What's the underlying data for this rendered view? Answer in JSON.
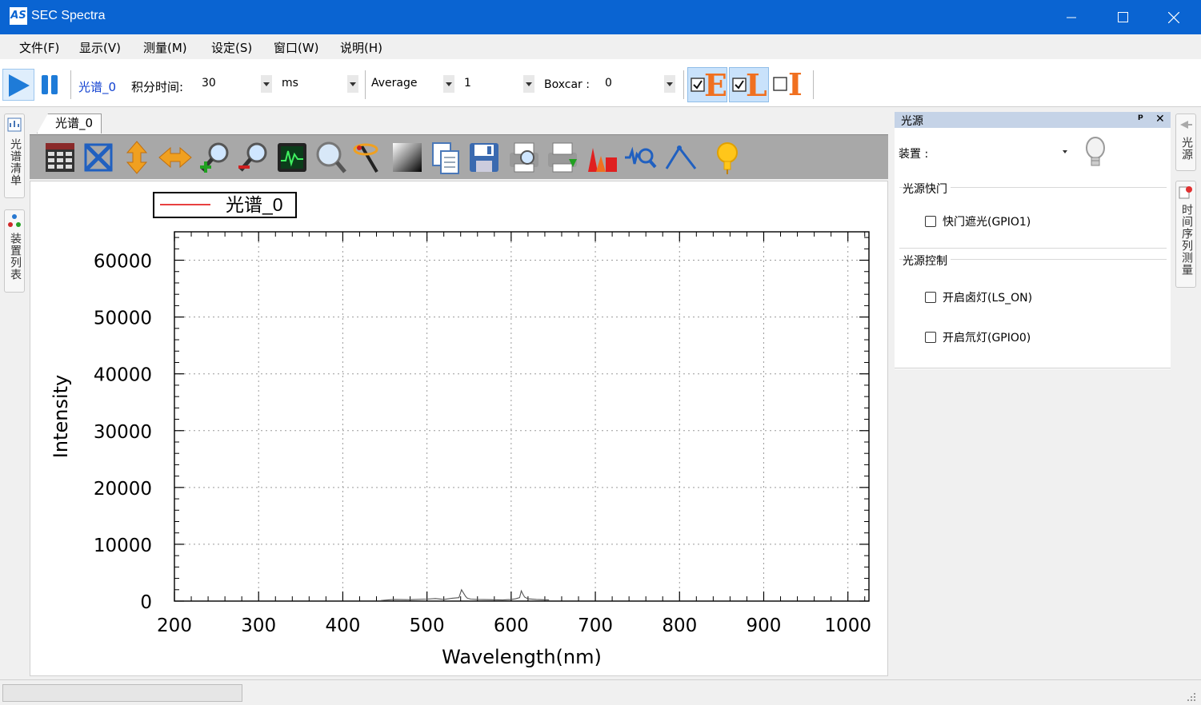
{
  "window": {
    "title": "SEC Spectra",
    "logo_text": "AS"
  },
  "menu": [
    "文件(F)",
    "显示(V)",
    "测量(M)",
    "设定(S)",
    "窗口(W)",
    "说明(H)"
  ],
  "toolbar": {
    "spectrum_link": "光谱_0",
    "integration_label": "积分时间:",
    "integration_value": "30",
    "unit_value": "ms",
    "mode_value": "Average",
    "average_value": "1",
    "boxcar_label": "Boxcar :",
    "boxcar_value": "0",
    "toggle_e": "E",
    "toggle_l": "L",
    "toggle_i": "I"
  },
  "left_tabs": [
    "光谱清单",
    "装置列表"
  ],
  "right_tabs": [
    "光源",
    "时间序列测量"
  ],
  "document": {
    "tab_label": "光谱_0"
  },
  "chart_toolbar_icons": [
    "data-table-icon",
    "zoom-fit-icon",
    "vertical-scale-icon",
    "horizontal-scale-icon",
    "zoom-in-icon",
    "zoom-out-icon",
    "oscilloscope-icon",
    "magnifier-icon",
    "peak-marker-icon",
    "gradient-icon",
    "copy-icon",
    "save-icon",
    "print-preview-icon",
    "print-icon",
    "color-spectrum-icon",
    "peak-search-icon",
    "measure-tool-icon",
    "lightbulb-icon"
  ],
  "chart_data": {
    "type": "line",
    "xlabel": "Wavelength(nm)",
    "ylabel": "Intensity",
    "xlim": [
      200,
      1025
    ],
    "ylim": [
      0,
      65000
    ],
    "x_ticks": [
      200,
      300,
      400,
      500,
      600,
      700,
      800,
      900,
      1000
    ],
    "y_ticks": [
      0,
      10000,
      20000,
      30000,
      40000,
      50000,
      60000
    ],
    "grid": true,
    "legend_position": "top-left",
    "series": [
      {
        "name": "光谱_0",
        "color": "#e00000",
        "x": [
          445,
          460,
          480,
          500,
          510,
          520,
          530,
          538,
          541,
          543,
          546,
          548,
          552,
          560,
          575,
          590,
          600,
          605,
          610,
          612,
          614,
          616,
          620,
          630,
          645
        ],
        "y": [
          100,
          300,
          250,
          350,
          450,
          300,
          500,
          600,
          2000,
          1500,
          800,
          500,
          350,
          300,
          250,
          200,
          300,
          400,
          600,
          1800,
          1200,
          700,
          400,
          300,
          200
        ]
      }
    ]
  },
  "light_panel": {
    "title": "光源",
    "pin_glyph": "ᵖ",
    "close_glyph": "✕",
    "device_label": "装置 :",
    "device_value": "",
    "shutter_group": "光源快门",
    "shutter_checkbox": "快门遮光(GPIO1)",
    "control_group": "光源控制",
    "halogen_checkbox": "开启卤灯(LS_ON)",
    "xenon_checkbox": "开启氘灯(GPIO0)"
  },
  "colors": {
    "titlebar": "#0a64d2",
    "panel_header": "#c5d3e7",
    "chart_toolbar": "#a8a8a8",
    "series": "#e00000"
  }
}
